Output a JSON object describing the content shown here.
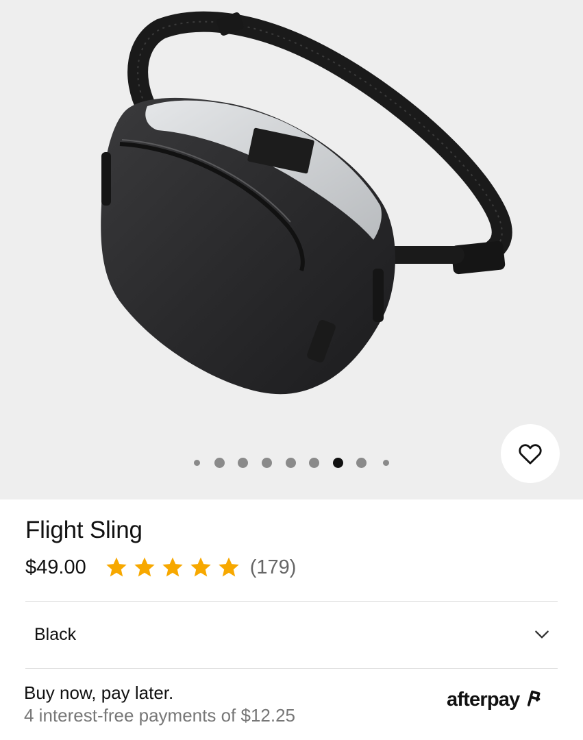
{
  "product": {
    "title": "Flight Sling",
    "price": "$49.00",
    "rating": 5,
    "review_count": "(179)",
    "star_color": "#f7a800"
  },
  "gallery": {
    "image_count": 9,
    "active_index": 6,
    "favorite_icon": "heart-outline-icon"
  },
  "variant": {
    "selected": "Black",
    "dropdown_icon": "chevron-down-icon"
  },
  "payment": {
    "headline": "Buy now, pay later.",
    "detail": "4 interest-free payments of $12.25",
    "provider_logo": "afterpay"
  }
}
